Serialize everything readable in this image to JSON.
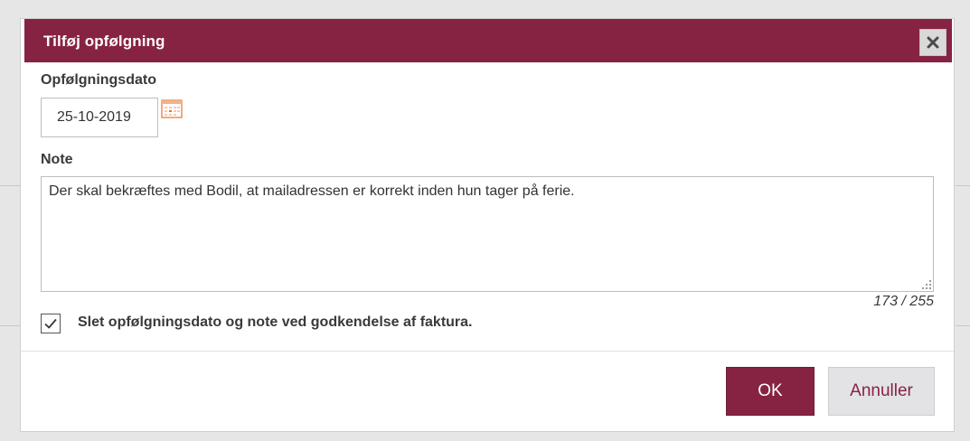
{
  "dialog": {
    "title": "Tilføj opfølgning",
    "close_icon": "close-x-icon"
  },
  "followup_date": {
    "label": "Opfølgningsdato",
    "value": "25-10-2019",
    "calendar_icon": "calendar-icon"
  },
  "note": {
    "label": "Note",
    "value": "Der skal bekræftes med Bodil, at mailadressen er korrekt inden hun tager på ferie.",
    "counter": "173 / 255"
  },
  "delete_option": {
    "checked": true,
    "label": "Slet opfølgningsdato og note ved godkendelse af faktura."
  },
  "buttons": {
    "ok_label": "OK",
    "cancel_label": "Annuller"
  },
  "colors": {
    "accent": "#872342",
    "button_secondary_bg": "#e3e3e6",
    "calendar_accent": "#e8722c"
  }
}
